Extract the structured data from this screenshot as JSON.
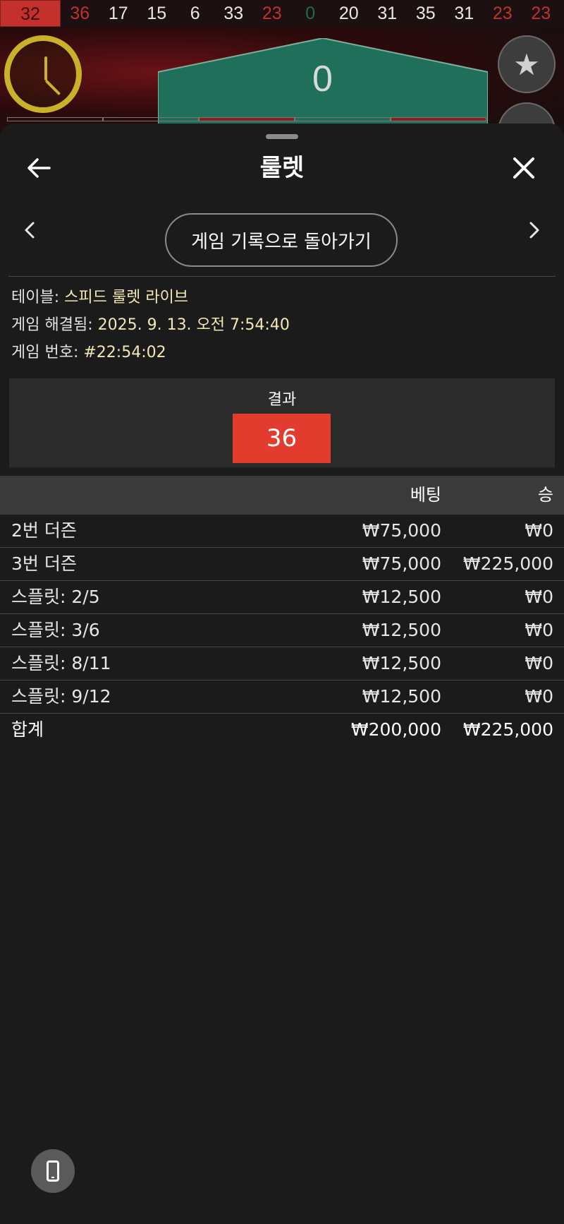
{
  "history": [
    {
      "value": "32",
      "color": "red",
      "highlight": true
    },
    {
      "value": "36",
      "color": "red"
    },
    {
      "value": "17",
      "color": "black"
    },
    {
      "value": "15",
      "color": "black"
    },
    {
      "value": "6",
      "color": "black"
    },
    {
      "value": "33",
      "color": "black"
    },
    {
      "value": "23",
      "color": "red"
    },
    {
      "value": "0",
      "color": "green"
    },
    {
      "value": "20",
      "color": "black"
    },
    {
      "value": "31",
      "color": "black"
    },
    {
      "value": "35",
      "color": "black"
    },
    {
      "value": "31",
      "color": "black"
    },
    {
      "value": "23",
      "color": "red"
    },
    {
      "value": "23",
      "color": "red"
    }
  ],
  "game": {
    "zero_label": "0"
  },
  "sheet": {
    "title": "룰렛",
    "back_to_history": "게임 기록으로 돌아가기",
    "info": {
      "table_label": "테이블:",
      "table_value": "스피드 룰렛 라이브",
      "resolved_label": "게임 해결됨:",
      "resolved_value": "2025. 9. 13. 오전 7:54:40",
      "game_no_label": "게임 번호:",
      "game_no_value": "#22:54:02"
    },
    "result": {
      "label": "결과",
      "value": "36",
      "color": "#e23c2e"
    }
  },
  "bets": {
    "header": {
      "bet": "베팅",
      "win": "승"
    },
    "rows": [
      {
        "name": "2번 더즌",
        "bet": "₩75,000",
        "win": "₩0"
      },
      {
        "name": "3번 더즌",
        "bet": "₩75,000",
        "win": "₩225,000"
      },
      {
        "name": "스플릿: 2/5",
        "bet": "₩12,500",
        "win": "₩0"
      },
      {
        "name": "스플릿: 3/6",
        "bet": "₩12,500",
        "win": "₩0"
      },
      {
        "name": "스플릿: 8/11",
        "bet": "₩12,500",
        "win": "₩0"
      },
      {
        "name": "스플릿: 9/12",
        "bet": "₩12,500",
        "win": "₩0"
      }
    ],
    "total": {
      "name": "합계",
      "bet": "₩200,000",
      "win": "₩225,000"
    }
  },
  "icons": {
    "back": "arrow-left-icon",
    "close": "close-icon",
    "prev": "chevron-left-icon",
    "next": "chevron-right-icon",
    "favorite": "star-icon",
    "device": "phone-icon",
    "timer": "clock-icon"
  }
}
